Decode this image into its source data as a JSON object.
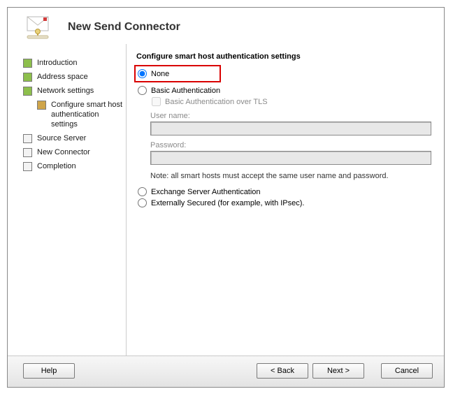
{
  "title": "New Send Connector",
  "sidebar": {
    "items": [
      {
        "label": "Introduction",
        "state": "done"
      },
      {
        "label": "Address space",
        "state": "done"
      },
      {
        "label": "Network settings",
        "state": "done"
      },
      {
        "label": "Configure smart host authentication settings",
        "state": "current",
        "sub": true
      },
      {
        "label": "Source Server",
        "state": "pending"
      },
      {
        "label": "New Connector",
        "state": "pending"
      },
      {
        "label": "Completion",
        "state": "pending"
      }
    ]
  },
  "content": {
    "section_title": "Configure smart host authentication settings",
    "radios": {
      "none": "None",
      "basic": "Basic Authentication",
      "basic_tls": "Basic Authentication over TLS",
      "exchange": "Exchange Server Authentication",
      "external": "Externally Secured (for example, with IPsec)."
    },
    "username_label": "User name:",
    "username_value": "",
    "password_label": "Password:",
    "password_value": "",
    "note": "Note: all smart hosts must accept the same user name and password."
  },
  "buttons": {
    "help": "Help",
    "back": "< Back",
    "next": "Next >",
    "cancel": "Cancel"
  }
}
